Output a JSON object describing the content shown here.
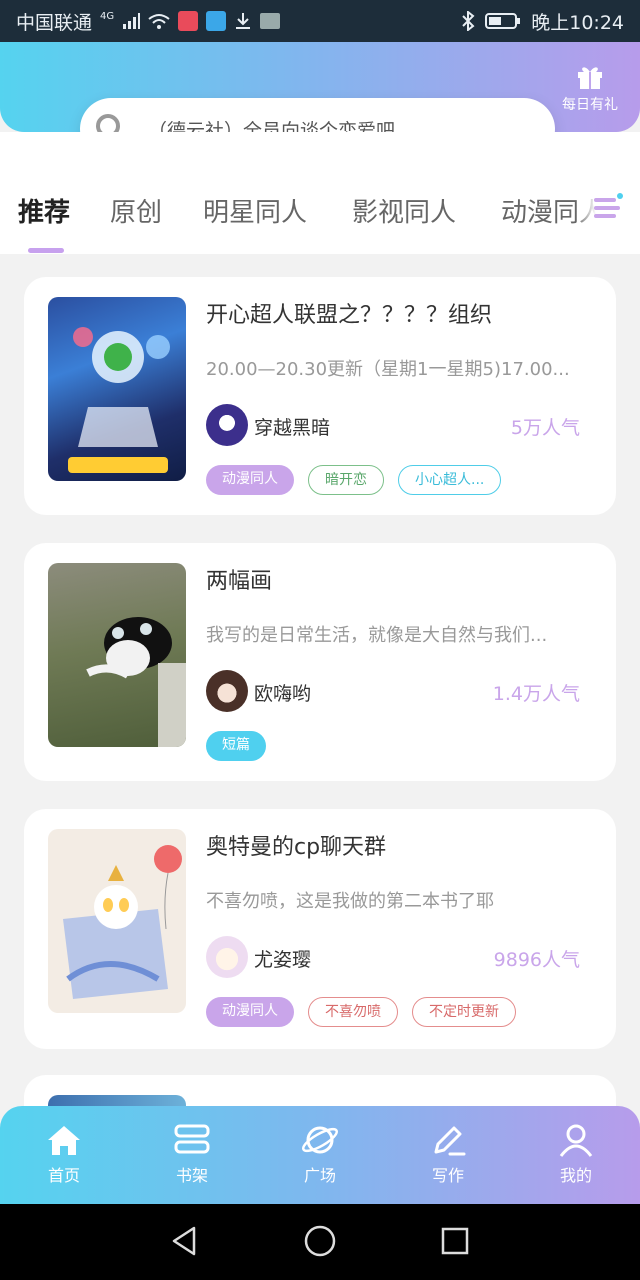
{
  "status_bar": {
    "carrier": "中国联通",
    "network": "4G",
    "time": "晚上10:24"
  },
  "header": {
    "gift_label": "每日有礼",
    "search_placeholder": "（德云社）全员向谈个恋爱吧"
  },
  "tabs": [
    "推荐",
    "原创",
    "明星同人",
    "影视同人",
    "动漫同人"
  ],
  "active_tab": "推荐",
  "colors": {
    "accent_purple": "#c9a5ea",
    "accent_blue": "#4fd0ef"
  },
  "books": [
    {
      "title": "开心超人联盟之？？？？组织",
      "desc": "20.00—20.30更新（星期1一星期5)17.00...",
      "author": "穿越黑暗",
      "popularity": "5万人气",
      "tags": [
        "动漫同人",
        "暗开恋",
        "小心超人..."
      ]
    },
    {
      "title": "两幅画",
      "desc": "我写的是日常生活，就像是大自然与我们...",
      "author": "欧嗨哟",
      "popularity": "1.4万人气",
      "tags": [
        "短篇"
      ]
    },
    {
      "title": "奥特曼的cp聊天群",
      "desc": "不喜勿喷，这是我做的第二本书了耶",
      "author": "尤姿璎",
      "popularity": "9896人气",
      "tags": [
        "动漫同人",
        "不喜勿喷",
        "不定时更新"
      ]
    }
  ],
  "bottom_nav": [
    "首页",
    "书架",
    "广场",
    "写作",
    "我的"
  ]
}
